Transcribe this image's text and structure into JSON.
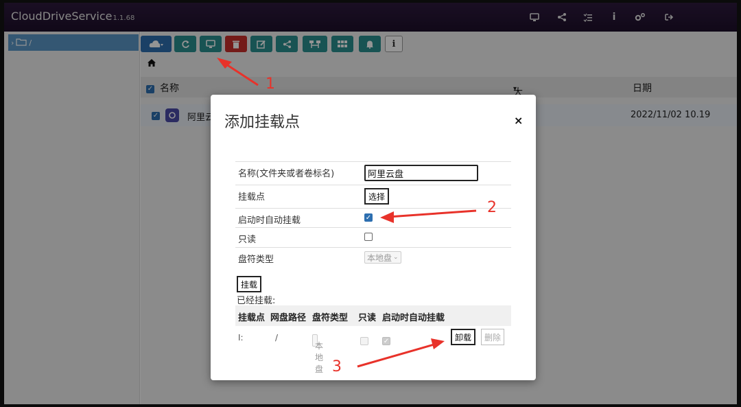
{
  "app": {
    "title": "CloudDriveService",
    "version": "1.1.68"
  },
  "header_icons": [
    "monitor-icon",
    "share-icon",
    "tasks-icon",
    "info-icon",
    "settings-icon",
    "logout-icon"
  ],
  "tree": {
    "root_label": "/"
  },
  "toolbar": {
    "buttons": [
      "cloud-dropdown",
      "refresh",
      "mount-point",
      "delete",
      "rename",
      "share",
      "sync",
      "grid",
      "bell",
      "info"
    ]
  },
  "file_list": {
    "columns": {
      "name": "名称",
      "size": "大小",
      "date": "日期"
    },
    "rows": [
      {
        "name": "阿里云",
        "date": "2022/11/02 10.19"
      }
    ]
  },
  "modal": {
    "title": "添加挂载点",
    "close": "×",
    "fields": {
      "name_label": "名称(文件夹或者卷标名)",
      "name_value": "阿里云盘",
      "mount_point_label": "挂载点",
      "choose_button": "选择",
      "auto_mount_label": "启动时自动挂载",
      "auto_mount_checked": true,
      "readonly_label": "只读",
      "readonly_checked": false,
      "drive_type_label": "盘符类型",
      "drive_type_value": "本地盘"
    },
    "mount_button": "挂载",
    "mounted_label": "已经挂载:",
    "mounted_table": {
      "headers": [
        "挂载点",
        "网盘路径",
        "盘符类型",
        "只读",
        "启动时自动挂载"
      ],
      "rows": [
        {
          "mount_point": "I:",
          "path": "/",
          "drive_type": "本地盘",
          "readonly": false,
          "auto_mount": true
        }
      ],
      "unmount_button": "卸载",
      "delete_button": "删除"
    }
  },
  "annotations": [
    "1",
    "2",
    "3"
  ],
  "colors": {
    "header_bg": "#2e1a3e",
    "teal_button": "#2a8f8f",
    "blue_button": "#2d6fb0",
    "red_button": "#c9302c",
    "arrow": "#e8322a"
  }
}
